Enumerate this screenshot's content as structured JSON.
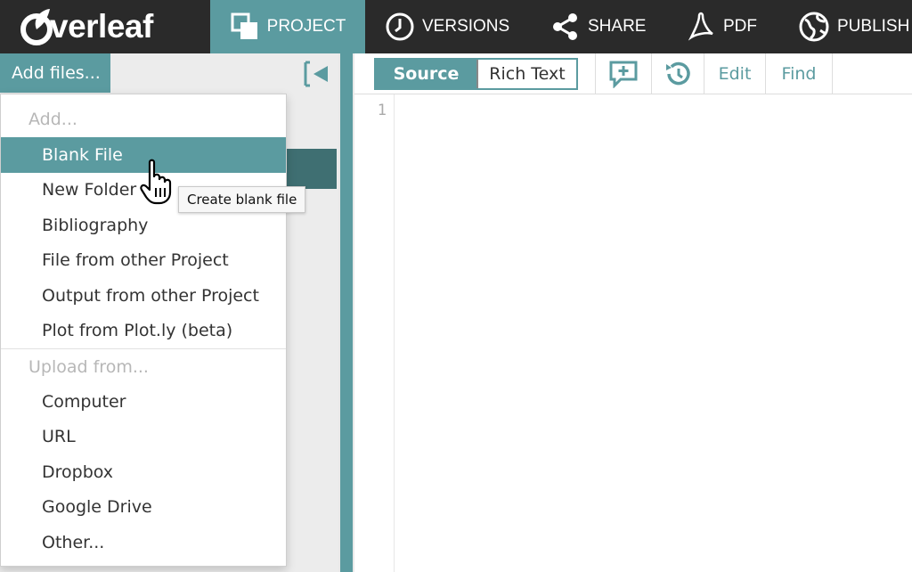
{
  "brand": {
    "logo_text": "verleaf"
  },
  "nav": {
    "project": "PROJECT",
    "versions": "VERSIONS",
    "share": "SHARE",
    "pdf": "PDF",
    "publish": "PUBLISH"
  },
  "left": {
    "add_files_label": "Add files..."
  },
  "menu": {
    "add_header": "Add...",
    "add_items": [
      "Blank File",
      "New Folder",
      "Bibliography",
      "File from other Project",
      "Output from other Project",
      "Plot from Plot.ly (beta)"
    ],
    "upload_header": "Upload from...",
    "upload_items": [
      "Computer",
      "URL",
      "Dropbox",
      "Google Drive",
      "Other..."
    ]
  },
  "tooltip": {
    "text": "Create blank file"
  },
  "editor": {
    "mode_source": "Source",
    "mode_rich": "Rich Text",
    "edit_label": "Edit",
    "find_label": "Find",
    "line_number": "1"
  },
  "colors": {
    "accent": "#5b9ba0",
    "topbar": "#2a2a2a",
    "selected_file": "#3f6f72"
  }
}
